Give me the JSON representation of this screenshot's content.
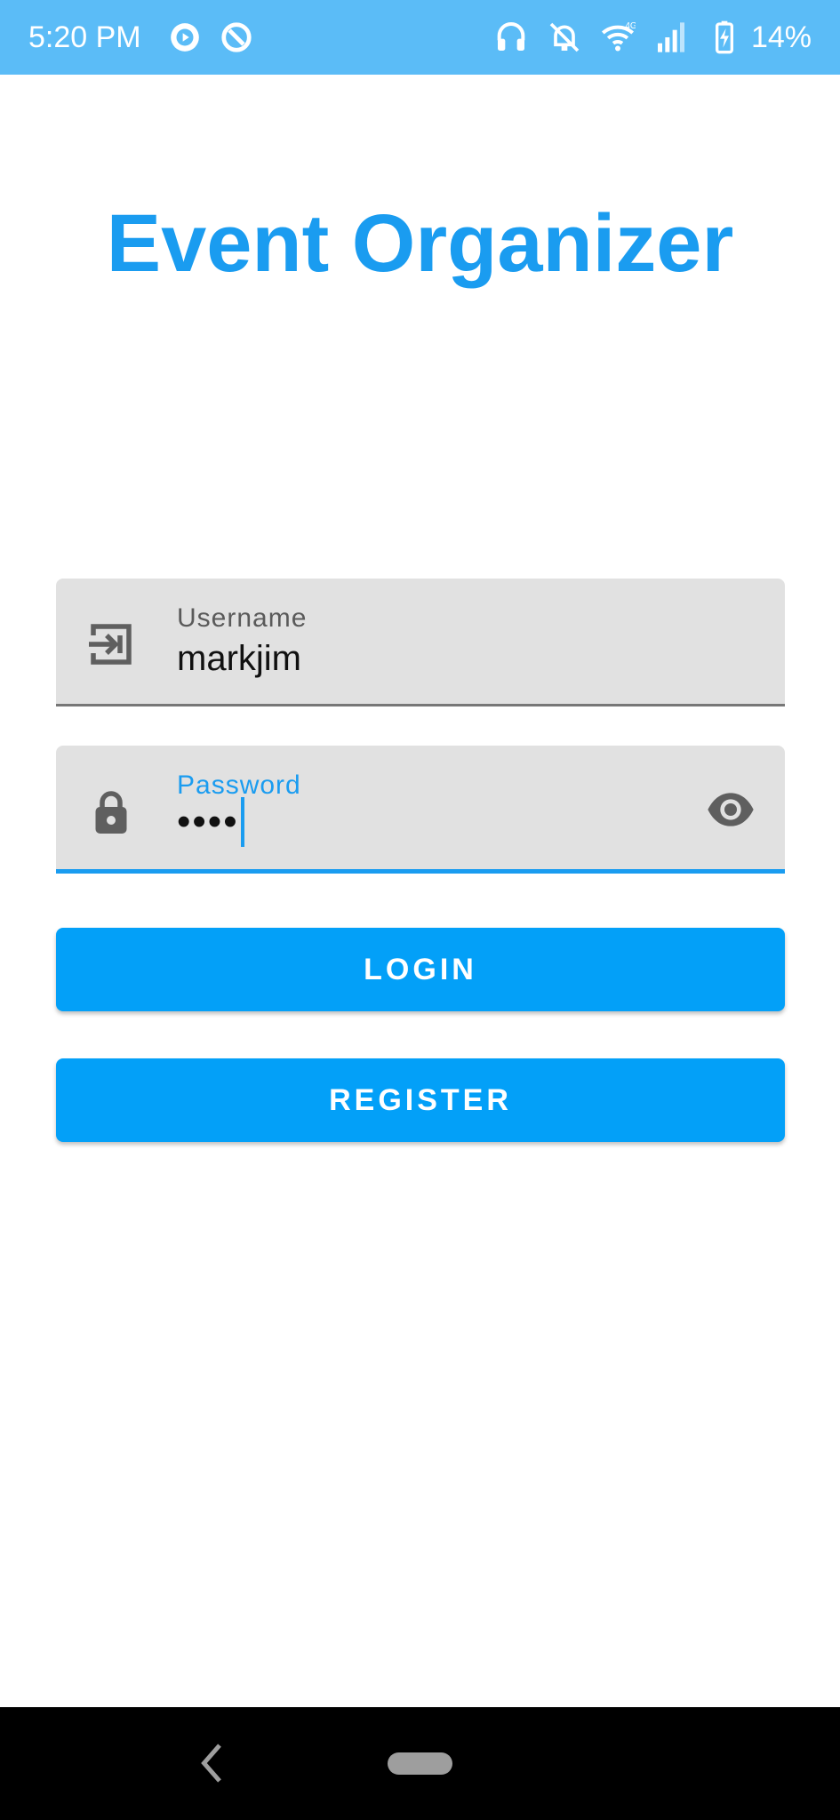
{
  "status_bar": {
    "time": "5:20 PM",
    "battery_percent": "14%",
    "network_label": "4G",
    "left_icons": [
      "media-play-icon",
      "sync-icon"
    ],
    "right_icons": [
      "headset-icon",
      "bell-off-icon",
      "wifi-icon",
      "signal-icon",
      "battery-charging-icon"
    ],
    "background_color": "#5bbcf7"
  },
  "app": {
    "title": "Event Organizer",
    "title_color": "#1a9cf0"
  },
  "form": {
    "username": {
      "label": "Username",
      "value": "markjim",
      "icon": "login-icon"
    },
    "password": {
      "label": "Password",
      "value": "••••",
      "icon": "lock-icon",
      "toggle_icon": "eye-icon",
      "focused": true
    }
  },
  "buttons": {
    "login_label": "LOGIN",
    "register_label": "REGISTER",
    "color": "#03a0f8"
  },
  "nav_bar": {
    "back_icon": "back-chevron-icon",
    "home_icon": "home-pill-icon"
  }
}
